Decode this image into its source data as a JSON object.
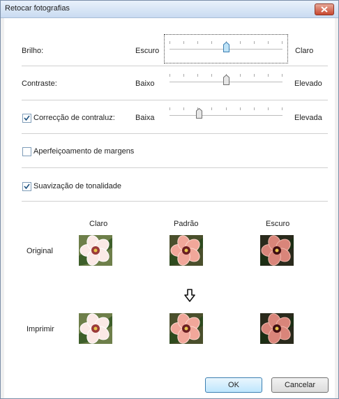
{
  "window": {
    "title": "Retocar fotografias"
  },
  "rows": {
    "brightness": {
      "label": "Brilho:",
      "min_label": "Escuro",
      "max_label": "Claro",
      "level": 0.5
    },
    "contrast": {
      "label": "Contraste:",
      "min_label": "Baixo",
      "max_label": "Elevado",
      "level": 0.5
    },
    "backlight": {
      "label": "Correcção de contraluz:",
      "checked": true,
      "min_label": "Baixa",
      "max_label": "Elevada",
      "level": 0.25
    },
    "edges": {
      "label": "Aperfeiçoamento de margens",
      "checked": false
    },
    "smoothing": {
      "label": "Suavização de tonalidade",
      "checked": true
    }
  },
  "preview": {
    "columns": [
      "Claro",
      "Padrão",
      "Escuro"
    ],
    "row_original": "Original",
    "row_print": "Imprimir",
    "arrow_icon": "down-arrow-icon"
  },
  "buttons": {
    "ok": "OK",
    "cancel": "Cancelar"
  },
  "colors": {
    "accent": "#3c7fb1",
    "close": "#c7472f"
  }
}
